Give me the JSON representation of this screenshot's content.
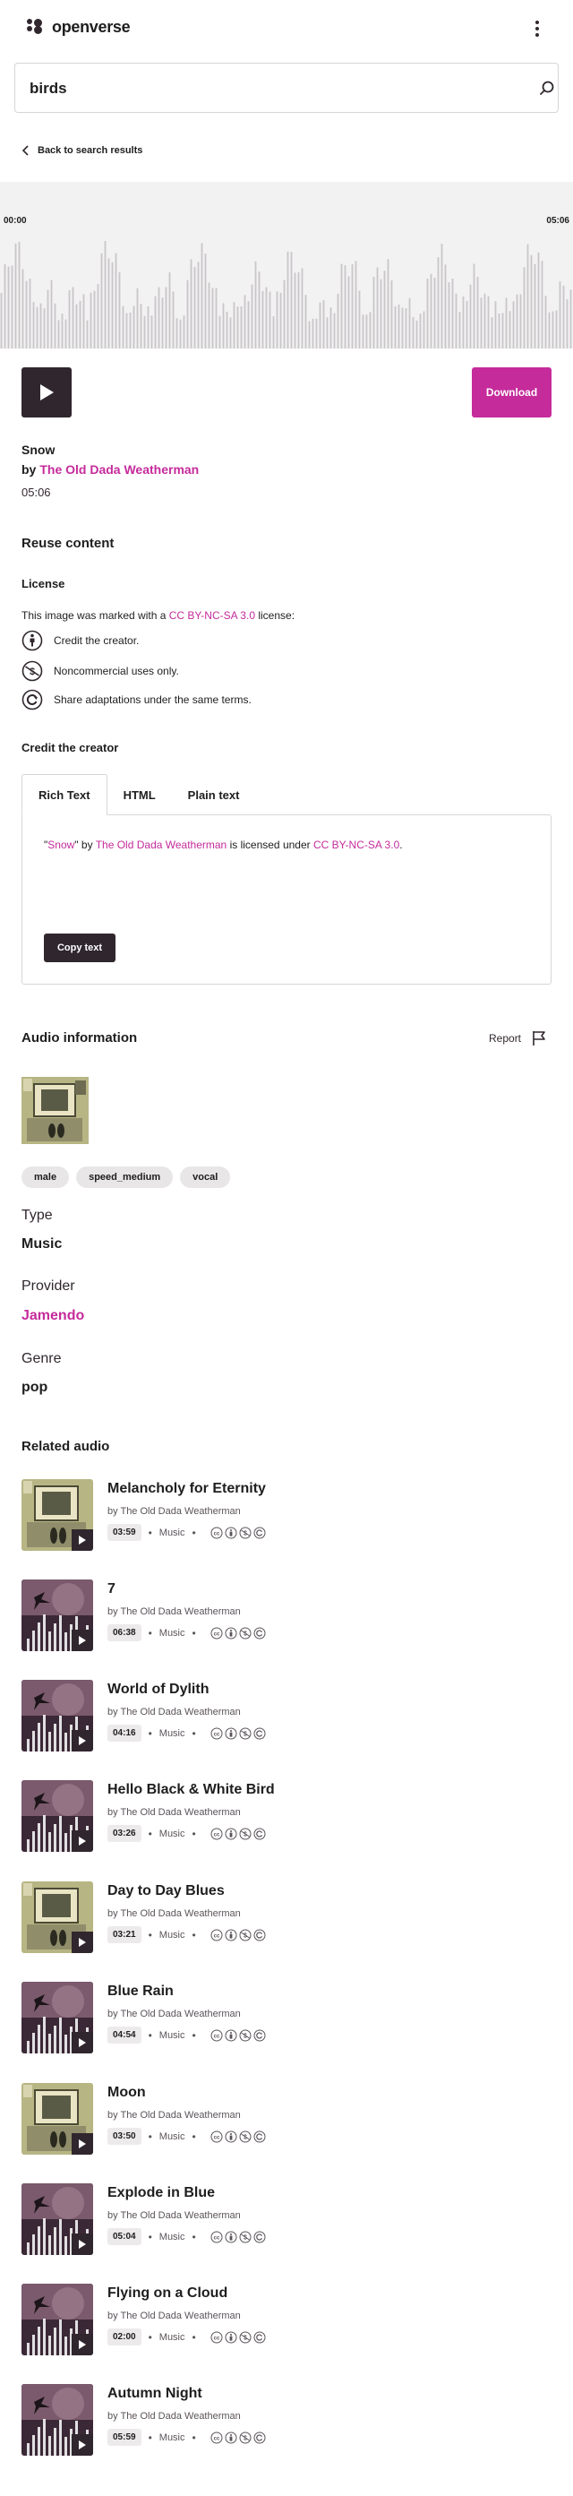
{
  "header": {
    "logo_text": "openverse",
    "menu_icon": "kebab-menu-icon"
  },
  "search": {
    "value": "birds",
    "icon": "search-icon"
  },
  "back_link": "Back to search results",
  "player": {
    "time_start": "00:00",
    "time_end": "05:06",
    "download_label": "Download"
  },
  "track": {
    "title": "Snow",
    "by_prefix": "by",
    "creator": "The Old Dada Weatherman",
    "duration": "05:06"
  },
  "reuse": {
    "heading": "Reuse content",
    "license_heading": "License",
    "license_prefix": "This image was marked with a",
    "license_name": "CC BY-NC-SA 3.0",
    "license_suffix": "license:",
    "terms": [
      {
        "icon": "cc-by-icon",
        "text": "Credit the creator."
      },
      {
        "icon": "cc-nc-icon",
        "text": "Noncommercial uses only."
      },
      {
        "icon": "cc-sa-icon",
        "text": "Share adaptations under the same terms."
      }
    ],
    "credit_heading": "Credit the creator",
    "tabs": [
      "Rich Text",
      "HTML",
      "Plain text"
    ],
    "attribution": {
      "open_quote": "\"",
      "title": "Snow",
      "close_quote_by": "\" by",
      "creator": "The Old Dada Weatherman",
      "middle": "is licensed under",
      "license": "CC BY-NC-SA 3.0",
      "end": "."
    },
    "copy_label": "Copy text"
  },
  "audio_info": {
    "heading": "Audio information",
    "report_label": "Report",
    "tags": [
      "male",
      "speed_medium",
      "vocal"
    ],
    "fields": [
      {
        "label": "Type",
        "value": "Music",
        "pink": false
      },
      {
        "label": "Provider",
        "value": "Jamendo",
        "pink": true
      },
      {
        "label": "Genre",
        "value": "pop",
        "pink": false
      }
    ]
  },
  "related": {
    "heading": "Related audio",
    "items": [
      {
        "title": "Melancholy for Eternity",
        "by": "by The Old Dada Weatherman",
        "duration": "03:59",
        "category": "Music",
        "art": "collage"
      },
      {
        "title": "7",
        "by": "by The Old Dada Weatherman",
        "duration": "06:38",
        "category": "Music",
        "art": "bird"
      },
      {
        "title": "World of Dylith",
        "by": "by The Old Dada Weatherman",
        "duration": "04:16",
        "category": "Music",
        "art": "bird"
      },
      {
        "title": "Hello Black & White Bird",
        "by": "by The Old Dada Weatherman",
        "duration": "03:26",
        "category": "Music",
        "art": "bird"
      },
      {
        "title": "Day to Day Blues",
        "by": "by The Old Dada Weatherman",
        "duration": "03:21",
        "category": "Music",
        "art": "collage"
      },
      {
        "title": "Blue Rain",
        "by": "by The Old Dada Weatherman",
        "duration": "04:54",
        "category": "Music",
        "art": "bird"
      },
      {
        "title": "Moon",
        "by": "by The Old Dada Weatherman",
        "duration": "03:50",
        "category": "Music",
        "art": "collage"
      },
      {
        "title": "Explode in Blue",
        "by": "by The Old Dada Weatherman",
        "duration": "05:04",
        "category": "Music",
        "art": "bird"
      },
      {
        "title": "Flying on a Cloud",
        "by": "by The Old Dada Weatherman",
        "duration": "02:00",
        "category": "Music",
        "art": "bird"
      },
      {
        "title": "Autumn Night",
        "by": "by The Old Dada Weatherman",
        "duration": "05:59",
        "category": "Music",
        "art": "bird"
      }
    ]
  },
  "colors": {
    "accent": "#c52b9b",
    "dark": "#30272e",
    "wave_bar": "#c9c6c8",
    "wave_bg": "#f3f2f3"
  }
}
